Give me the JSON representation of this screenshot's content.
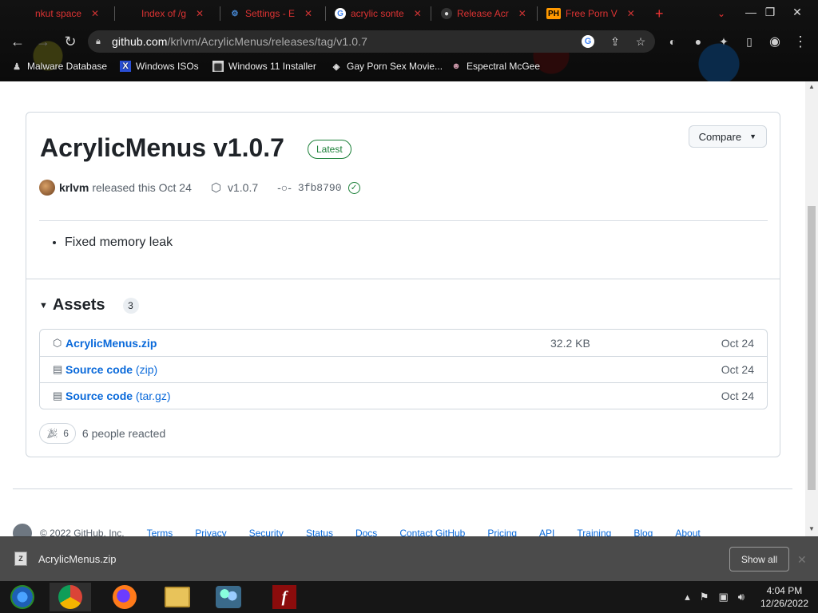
{
  "browser": {
    "tabs": [
      {
        "title": "nkut space"
      },
      {
        "title": "Index of /g"
      },
      {
        "title": "Settings - E"
      },
      {
        "title": "acrylic sonte"
      },
      {
        "title": "Release Acr"
      },
      {
        "title": "Free Porn V"
      }
    ],
    "url": {
      "domain": "github.com",
      "path": "/krlvm/AcrylicMenus/releases/tag/v1.0.7"
    },
    "bookmarks": [
      {
        "label": "Malware Database"
      },
      {
        "label": "Windows ISOs"
      },
      {
        "label": "Windows 11 Installer"
      },
      {
        "label": "Gay Porn Sex Movie..."
      },
      {
        "label": "Espectral McGee"
      }
    ]
  },
  "release": {
    "title": "AcrylicMenus v1.0.7",
    "badge": "Latest",
    "compare_label": "Compare",
    "author": "krlvm",
    "released_text": "released this Oct 24",
    "tag": "v1.0.7",
    "commit": "3fb8790",
    "notes": [
      "Fixed memory leak"
    ]
  },
  "assets": {
    "heading": "Assets",
    "count": "3",
    "items": [
      {
        "name": "AcrylicMenus.zip",
        "suffix": "",
        "size": "32.2 KB",
        "date": "Oct 24"
      },
      {
        "name": "Source code",
        "suffix": "(zip)",
        "size": "",
        "date": "Oct 24"
      },
      {
        "name": "Source code",
        "suffix": "(tar.gz)",
        "size": "",
        "date": "Oct 24"
      }
    ]
  },
  "reactions": {
    "count": "6",
    "text": "6 people reacted"
  },
  "footer": {
    "copyright": "© 2022 GitHub, Inc.",
    "links": [
      "Terms",
      "Privacy",
      "Security",
      "Status",
      "Docs",
      "Contact GitHub",
      "Pricing",
      "API",
      "Training",
      "Blog",
      "About"
    ]
  },
  "download_bar": {
    "filename": "AcrylicMenus.zip",
    "show_all": "Show all"
  },
  "taskbar": {
    "time": "4:04 PM",
    "date": "12/26/2022"
  },
  "colors": {
    "link": "#0969da",
    "success": "#1a7f37",
    "chrome_bg": "#0b0b0b"
  }
}
